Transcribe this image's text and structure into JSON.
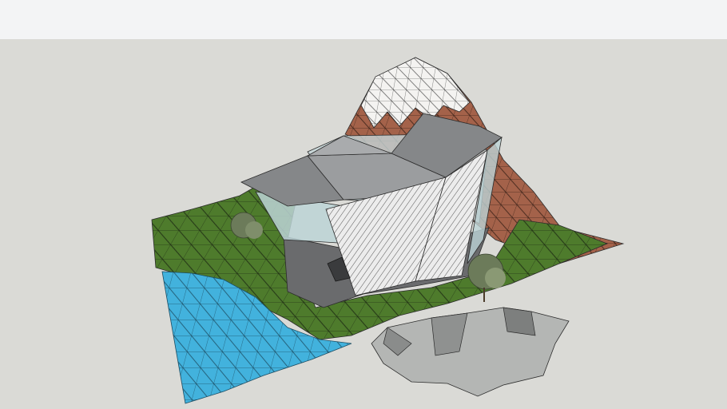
{
  "viewport": {
    "sky_color": "#f3f4f5",
    "ground_color": "#dadad6"
  },
  "colors": {
    "grass": "#4e7b2c",
    "grass_light": "#5d8d34",
    "water": "#42b2dd",
    "mountain_rock": "#a4624a",
    "snow": "#f4f3f1",
    "glass": "#bcd3d6",
    "roof_dark": "#858789",
    "wall_white": "#ececec",
    "concrete": "#6a6b6d",
    "rock_gray": "#b4b6b4",
    "tree": "#6c7b5a",
    "edge": "#2b2b2b"
  }
}
